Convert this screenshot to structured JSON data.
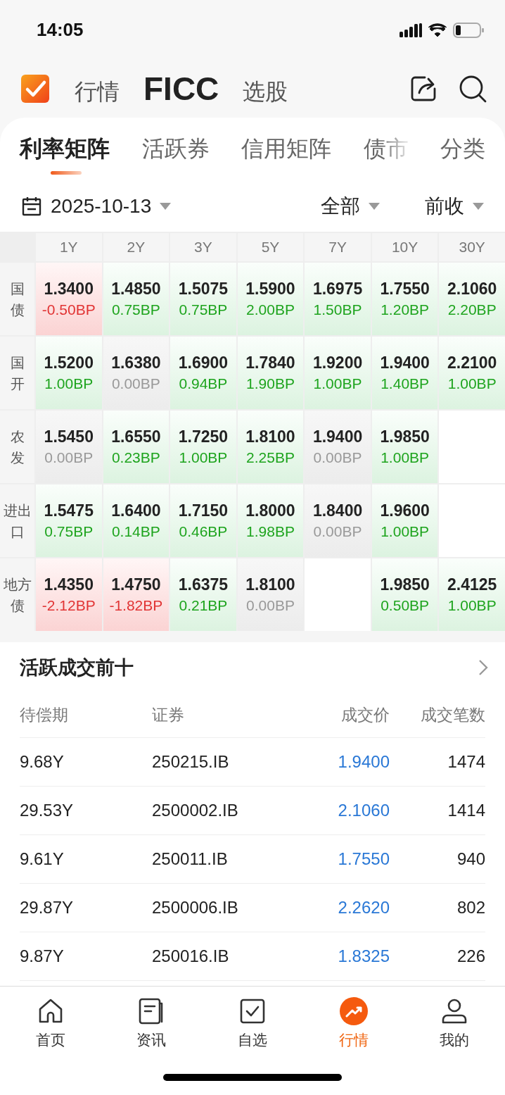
{
  "status_bar": {
    "time": "14:05"
  },
  "header": {
    "tabs": [
      {
        "label": "行情",
        "selected": false
      },
      {
        "label": "FICC",
        "selected": true
      },
      {
        "label": "选股",
        "selected": false
      }
    ]
  },
  "sub_tabs": [
    {
      "label": "利率矩阵",
      "selected": true,
      "faded": false
    },
    {
      "label": "活跃券",
      "selected": false,
      "faded": false
    },
    {
      "label": "信用矩阵",
      "selected": false,
      "faded": false
    },
    {
      "label": "债市",
      "selected": false,
      "faded": true
    },
    {
      "label": "分类",
      "selected": false,
      "faded": false
    }
  ],
  "filters": {
    "date": "2025-10-13",
    "scope": "全部",
    "basis": "前收"
  },
  "matrix": {
    "columns": [
      "1Y",
      "2Y",
      "3Y",
      "5Y",
      "7Y",
      "10Y",
      "30Y"
    ],
    "rows": [
      {
        "label": "国债",
        "cells": [
          {
            "kind": "down",
            "yield": "1.3400",
            "change": "-0.50BP"
          },
          {
            "kind": "up",
            "yield": "1.4850",
            "change": "0.75BP"
          },
          {
            "kind": "up",
            "yield": "1.5075",
            "change": "0.75BP"
          },
          {
            "kind": "up",
            "yield": "1.5900",
            "change": "2.00BP"
          },
          {
            "kind": "up",
            "yield": "1.6975",
            "change": "1.50BP"
          },
          {
            "kind": "up",
            "yield": "1.7550",
            "change": "1.20BP"
          },
          {
            "kind": "up",
            "yield": "2.1060",
            "change": "2.20BP"
          }
        ]
      },
      {
        "label": "国开",
        "cells": [
          {
            "kind": "up",
            "yield": "1.5200",
            "change": "1.00BP"
          },
          {
            "kind": "flat",
            "yield": "1.6380",
            "change": "0.00BP"
          },
          {
            "kind": "up",
            "yield": "1.6900",
            "change": "0.94BP"
          },
          {
            "kind": "up",
            "yield": "1.7840",
            "change": "1.90BP"
          },
          {
            "kind": "up",
            "yield": "1.9200",
            "change": "1.00BP"
          },
          {
            "kind": "up",
            "yield": "1.9400",
            "change": "1.40BP"
          },
          {
            "kind": "up",
            "yield": "2.2100",
            "change": "1.00BP"
          }
        ]
      },
      {
        "label": "农发",
        "cells": [
          {
            "kind": "flat",
            "yield": "1.5450",
            "change": "0.00BP"
          },
          {
            "kind": "up",
            "yield": "1.6550",
            "change": "0.23BP"
          },
          {
            "kind": "up",
            "yield": "1.7250",
            "change": "1.00BP"
          },
          {
            "kind": "up",
            "yield": "1.8100",
            "change": "2.25BP"
          },
          {
            "kind": "flat",
            "yield": "1.9400",
            "change": "0.00BP"
          },
          {
            "kind": "up",
            "yield": "1.9850",
            "change": "1.00BP"
          },
          {
            "kind": "empty"
          }
        ]
      },
      {
        "label": "进出口",
        "cells": [
          {
            "kind": "up",
            "yield": "1.5475",
            "change": "0.75BP"
          },
          {
            "kind": "up",
            "yield": "1.6400",
            "change": "0.14BP"
          },
          {
            "kind": "up",
            "yield": "1.7150",
            "change": "0.46BP"
          },
          {
            "kind": "up",
            "yield": "1.8000",
            "change": "1.98BP"
          },
          {
            "kind": "flat",
            "yield": "1.8400",
            "change": "0.00BP"
          },
          {
            "kind": "up",
            "yield": "1.9600",
            "change": "1.00BP"
          },
          {
            "kind": "empty"
          }
        ]
      },
      {
        "label": "地方债",
        "cells": [
          {
            "kind": "down",
            "yield": "1.4350",
            "change": "-2.12BP"
          },
          {
            "kind": "down",
            "yield": "1.4750",
            "change": "-1.82BP"
          },
          {
            "kind": "up",
            "yield": "1.6375",
            "change": "0.21BP"
          },
          {
            "kind": "flat",
            "yield": "1.8100",
            "change": "0.00BP"
          },
          {
            "kind": "empty"
          },
          {
            "kind": "up",
            "yield": "1.9850",
            "change": "0.50BP"
          },
          {
            "kind": "up",
            "yield": "2.4125",
            "change": "1.00BP"
          }
        ]
      }
    ]
  },
  "active_trades": {
    "title": "活跃成交前十",
    "columns": [
      "待偿期",
      "证券",
      "成交价",
      "成交笔数"
    ],
    "rows": [
      {
        "term": "9.68Y",
        "security": "250215.IB",
        "price": "1.9400",
        "count": "1474"
      },
      {
        "term": "29.53Y",
        "security": "2500002.IB",
        "price": "2.1060",
        "count": "1414"
      },
      {
        "term": "9.61Y",
        "security": "250011.IB",
        "price": "1.7550",
        "count": "940"
      },
      {
        "term": "29.87Y",
        "security": "2500006.IB",
        "price": "2.2620",
        "count": "802"
      },
      {
        "term": "9.87Y",
        "security": "250016.IB",
        "price": "1.8325",
        "count": "226"
      }
    ]
  },
  "tab_bar": [
    {
      "label": "首页",
      "kind": "home",
      "selected": false
    },
    {
      "label": "资讯",
      "kind": "news",
      "selected": false
    },
    {
      "label": "自选",
      "kind": "check",
      "selected": false
    },
    {
      "label": "行情",
      "kind": "trend",
      "selected": true
    },
    {
      "label": "我的",
      "kind": "user",
      "selected": false
    }
  ]
}
